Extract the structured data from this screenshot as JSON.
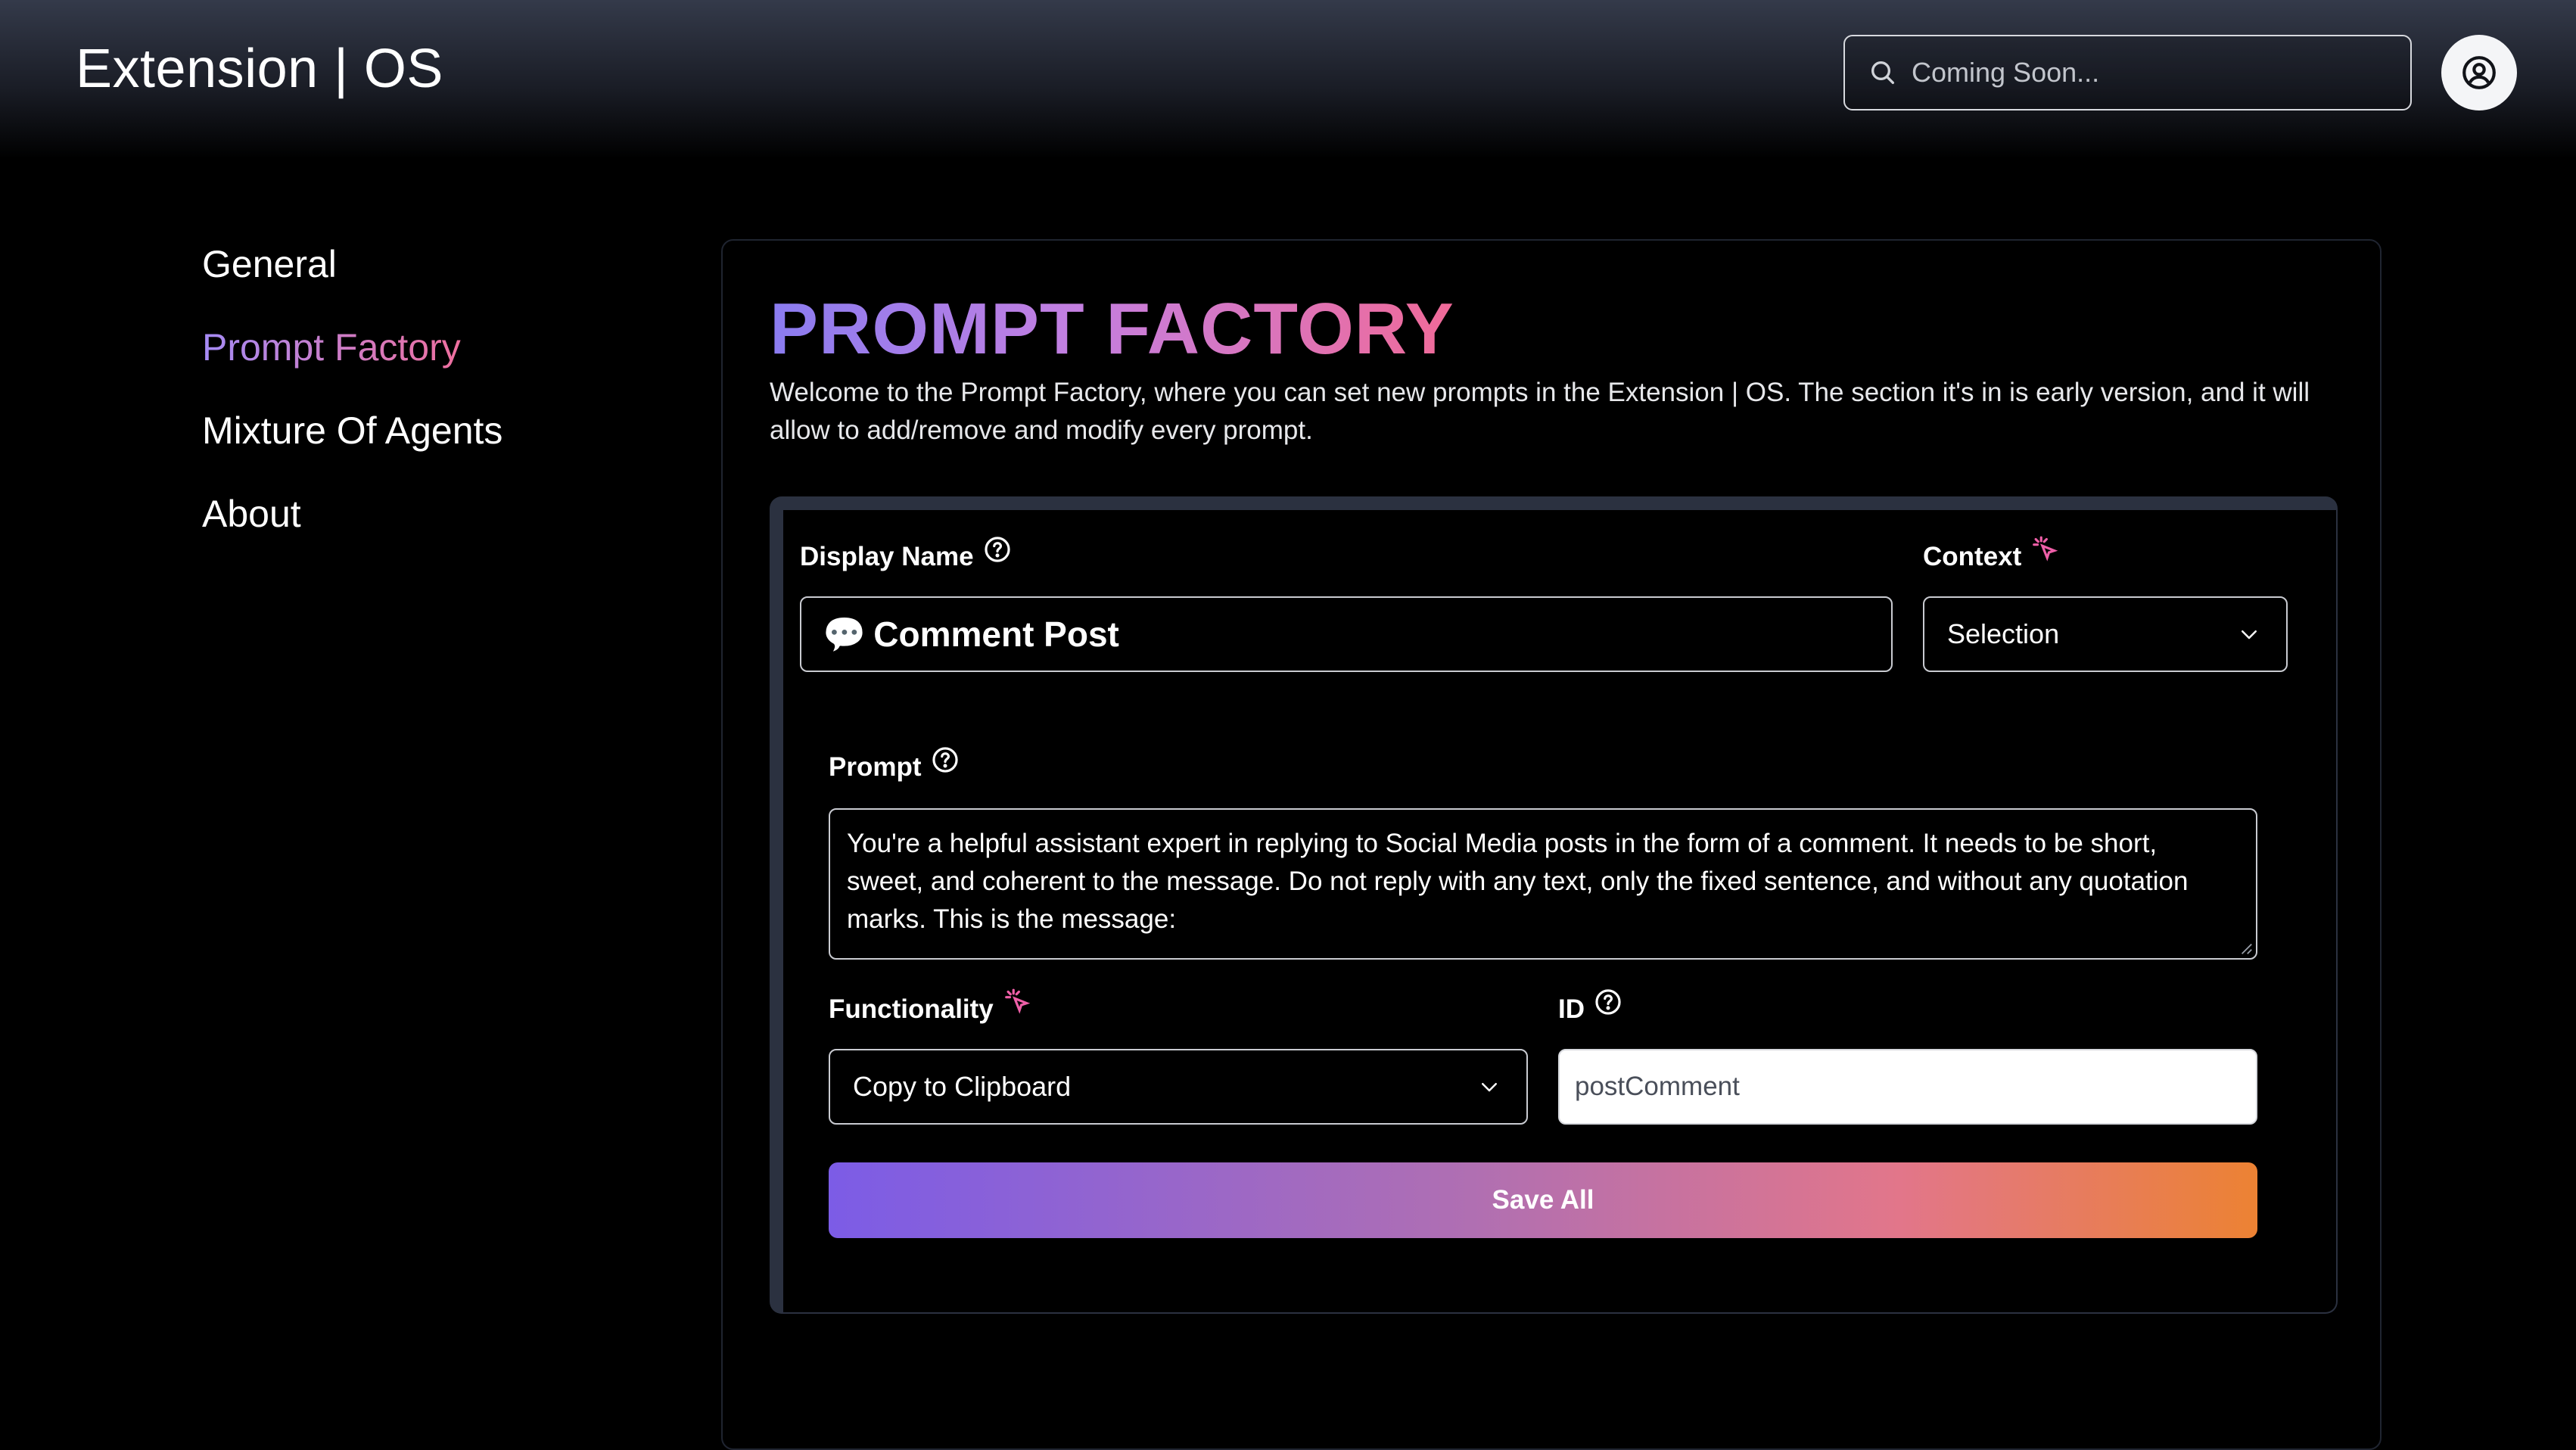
{
  "header": {
    "app_title": "Extension | OS",
    "search_placeholder": "Coming Soon...",
    "search_icon": "search-icon",
    "profile_icon": "user-circle-icon"
  },
  "sidebar": {
    "items": [
      {
        "label": "General",
        "active": false
      },
      {
        "label": "Prompt Factory",
        "active": true
      },
      {
        "label": "Mixture Of Agents",
        "active": false
      },
      {
        "label": "About",
        "active": false
      }
    ]
  },
  "main": {
    "title": "PROMPT FACTORY",
    "description": "Welcome to the Prompt Factory, where you can set new prompts in the Extension | OS. The section it's in is early version, and it will allow to add/remove and modify every prompt.",
    "form": {
      "display_name_label": "Display Name",
      "display_name_emoji": "💬",
      "display_name_value": "Comment Post",
      "context_label": "Context",
      "context_value": "Selection",
      "prompt_label": "Prompt",
      "prompt_value": "You're a helpful assistant expert in replying to Social Media posts in the form of a comment. It needs to be short, sweet, and coherent to the message. Do not reply with any text, only the fixed sentence, and without any quotation marks. This is the message:",
      "functionality_label": "Functionality",
      "functionality_value": "Copy to Clipboard",
      "id_label": "ID",
      "id_value": "postComment",
      "save_label": "Save All"
    }
  },
  "colors": {
    "accent_gradient_start": "#7c5ce6",
    "accent_gradient_end": "#ec8233",
    "active_nav_start": "#a58bf5",
    "active_nav_end": "#ef6f9e",
    "sparkle": "#ef5fa8"
  }
}
